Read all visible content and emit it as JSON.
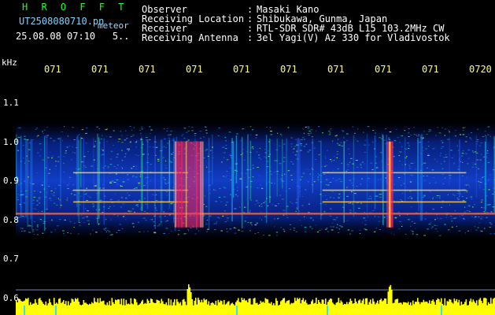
{
  "header": {
    "brand": "H R O F F T",
    "filename": "UT2508080710.pn",
    "mode": "meteor",
    "datetime": "25.08.08 07:10   5..",
    "info": [
      {
        "label": "Observer",
        "value": "Masaki Kano"
      },
      {
        "label": "Receiving Location",
        "value": "Shibukawa, Gunma, Japan"
      },
      {
        "label": "Receiver",
        "value": "RTL-SDR SDR# 43dB L15 103.2MHz CW"
      },
      {
        "label": "Receiving Antenna",
        "value": "3el Yagi(V) Az 330 for Vladivostok"
      }
    ]
  },
  "colors": {
    "background": "#000000",
    "yellow": "#ffff00",
    "green_text": "#22ff22",
    "filename_text": "#7dd3ff"
  },
  "chart_data": {
    "type": "heatmap",
    "yunit": "kHz",
    "yticks": [
      "1.1",
      "1.0",
      "0.9",
      "0.8",
      "0.7",
      "0.6"
    ],
    "xticks": [
      "071",
      "071",
      "071",
      "071",
      "071",
      "071",
      "071",
      "071",
      "071",
      "0720"
    ],
    "ylim": [
      0.58,
      1.18
    ],
    "xlim": [
      0,
      10
    ],
    "carrier_lines_khz": [
      0.815,
      0.845,
      0.875,
      0.92
    ],
    "meteor_bursts_x": [
      3.6,
      7.8
    ],
    "signal_band_khz": [
      0.78,
      1.02
    ]
  }
}
